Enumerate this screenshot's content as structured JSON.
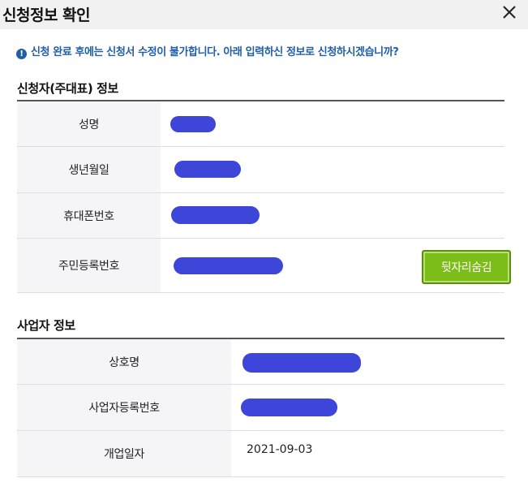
{
  "dialog": {
    "title": "신청정보 확인",
    "notice": "신청 완료 후에는 신청서 수정이 불가합니다. 아래 입력하신 정보로 신청하시겠습니까?"
  },
  "applicant": {
    "heading": "신청자(주대표) 정보",
    "rows": [
      {
        "label": "성명"
      },
      {
        "label": "생년월일"
      },
      {
        "label": "휴대폰번호"
      },
      {
        "label": "주민등록번호"
      }
    ],
    "hide_button_label": "뒷자리숨김"
  },
  "business": {
    "heading": "사업자 정보",
    "rows": [
      {
        "label": "상호명"
      },
      {
        "label": "사업자등록번호"
      },
      {
        "label": "개업일자",
        "value": "2021-09-03"
      }
    ]
  },
  "colors": {
    "notice": "#1f5ea8",
    "redaction": "#3d46d8",
    "hide_button": "#7cbd1a"
  }
}
